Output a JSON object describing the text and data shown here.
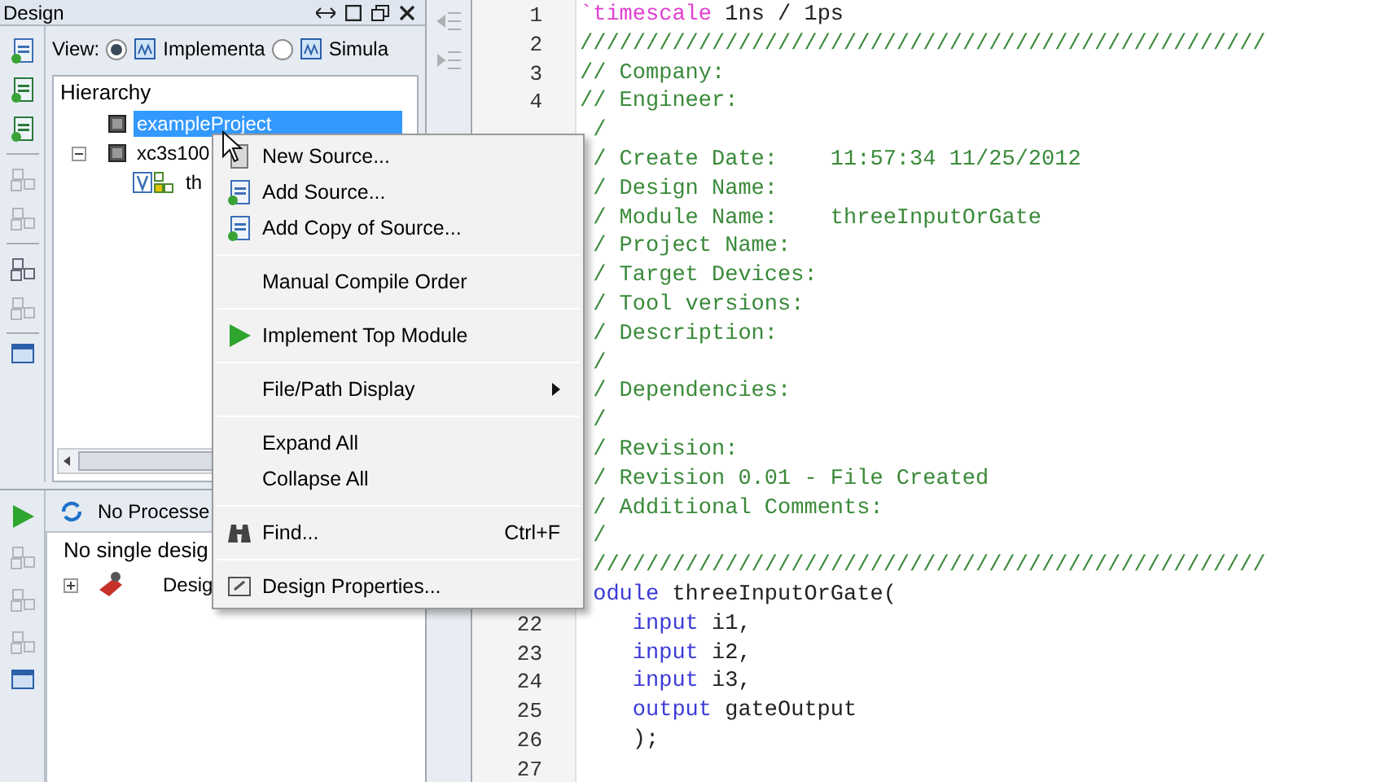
{
  "design_panel": {
    "title": "Design",
    "view": {
      "label": "View:",
      "options": [
        {
          "label": "Implementa",
          "selected": true
        },
        {
          "label": "Simula",
          "selected": false
        }
      ]
    },
    "hierarchy": {
      "header": "Hierarchy",
      "items": [
        {
          "label": "exampleProject",
          "selected": true
        },
        {
          "label": "xc3s100",
          "selected": false,
          "expanded": true,
          "children": [
            {
              "label": "th",
              "selected": false
            }
          ]
        }
      ]
    },
    "processes": {
      "label": "No Processe",
      "header": "No single desig",
      "items": [
        {
          "label": "Desig",
          "expanded": false
        }
      ]
    }
  },
  "context_menu": {
    "items": [
      {
        "kind": "item",
        "label": "New Source..."
      },
      {
        "kind": "item",
        "label": "Add Source..."
      },
      {
        "kind": "item",
        "label": "Add Copy of Source..."
      },
      {
        "kind": "separator"
      },
      {
        "kind": "item",
        "label": "Manual Compile Order"
      },
      {
        "kind": "separator"
      },
      {
        "kind": "item",
        "label": "Implement Top Module"
      },
      {
        "kind": "separator"
      },
      {
        "kind": "item",
        "label": "File/Path Display",
        "submenu": true
      },
      {
        "kind": "separator"
      },
      {
        "kind": "item",
        "label": "Expand All"
      },
      {
        "kind": "item",
        "label": "Collapse All"
      },
      {
        "kind": "separator"
      },
      {
        "kind": "item",
        "label": "Find...",
        "shortcut": "Ctrl+F"
      },
      {
        "kind": "separator"
      },
      {
        "kind": "item",
        "label": "Design Properties..."
      }
    ]
  },
  "editor": {
    "lines": [
      {
        "number": "1",
        "kind": "full",
        "segments": [
          {
            "kind": "directive",
            "text": "`timescale"
          },
          {
            "kind": "plain",
            "text": " 1ns / 1ps"
          }
        ]
      },
      {
        "number": "2",
        "kind": "full",
        "segments": [
          {
            "kind": "comment",
            "text": "////////////////////////////////////////////////////"
          }
        ]
      },
      {
        "number": "3",
        "kind": "full",
        "segments": [
          {
            "kind": "comment",
            "text": "// Company:"
          }
        ]
      },
      {
        "number": "4",
        "kind": "full",
        "segments": [
          {
            "kind": "comment",
            "text": "// Engineer:"
          }
        ]
      },
      {
        "kind": "partial",
        "segments": [
          {
            "kind": "comment",
            "text": "/"
          }
        ]
      },
      {
        "kind": "partial",
        "segments": [
          {
            "kind": "comment",
            "text": "/ Create Date:    11:57:34 11/25/2012"
          }
        ]
      },
      {
        "kind": "partial",
        "segments": [
          {
            "kind": "comment",
            "text": "/ Design Name:"
          }
        ]
      },
      {
        "kind": "partial",
        "segments": [
          {
            "kind": "comment",
            "text": "/ Module Name:    threeInputOrGate"
          }
        ]
      },
      {
        "kind": "partial",
        "segments": [
          {
            "kind": "comment",
            "text": "/ Project Name:"
          }
        ]
      },
      {
        "kind": "partial",
        "segments": [
          {
            "kind": "comment",
            "text": "/ Target Devices:"
          }
        ]
      },
      {
        "kind": "partial",
        "segments": [
          {
            "kind": "comment",
            "text": "/ Tool versions:"
          }
        ]
      },
      {
        "kind": "partial",
        "segments": [
          {
            "kind": "comment",
            "text": "/ Description:"
          }
        ]
      },
      {
        "kind": "partial",
        "segments": [
          {
            "kind": "comment",
            "text": "/"
          }
        ]
      },
      {
        "kind": "partial",
        "segments": [
          {
            "kind": "comment",
            "text": "/ Dependencies:"
          }
        ]
      },
      {
        "kind": "partial",
        "segments": [
          {
            "kind": "comment",
            "text": "/"
          }
        ]
      },
      {
        "kind": "partial",
        "segments": [
          {
            "kind": "comment",
            "text": "/ Revision:"
          }
        ]
      },
      {
        "kind": "partial",
        "segments": [
          {
            "kind": "comment",
            "text": "/ Revision 0.01 - File Created"
          }
        ]
      },
      {
        "kind": "partial",
        "segments": [
          {
            "kind": "comment",
            "text": "/ Additional Comments:"
          }
        ]
      },
      {
        "kind": "partial",
        "segments": [
          {
            "kind": "comment",
            "text": "/"
          }
        ]
      },
      {
        "kind": "partial",
        "segments": [
          {
            "kind": "comment",
            "text": "///////////////////////////////////////////////////"
          }
        ]
      },
      {
        "kind": "partial",
        "segments": [
          {
            "kind": "keyword",
            "text": "odule"
          },
          {
            "kind": "plain",
            "text": " threeInputOrGate("
          }
        ]
      },
      {
        "number": "22",
        "kind": "indented",
        "segments": [
          {
            "kind": "keyword",
            "text": "input"
          },
          {
            "kind": "plain",
            "text": " i1,"
          }
        ]
      },
      {
        "number": "23",
        "kind": "indented",
        "segments": [
          {
            "kind": "keyword",
            "text": "input"
          },
          {
            "kind": "plain",
            "text": " i2,"
          }
        ]
      },
      {
        "number": "24",
        "kind": "indented",
        "segments": [
          {
            "kind": "keyword",
            "text": "input"
          },
          {
            "kind": "plain",
            "text": " i3,"
          }
        ]
      },
      {
        "number": "25",
        "kind": "indented",
        "segments": [
          {
            "kind": "keyword",
            "text": "output"
          },
          {
            "kind": "plain",
            "text": " gateOutput"
          }
        ]
      },
      {
        "number": "26",
        "kind": "indented",
        "segments": [
          {
            "kind": "plain",
            "text": ");"
          }
        ]
      },
      {
        "number": "27",
        "kind": "full"
      }
    ]
  }
}
